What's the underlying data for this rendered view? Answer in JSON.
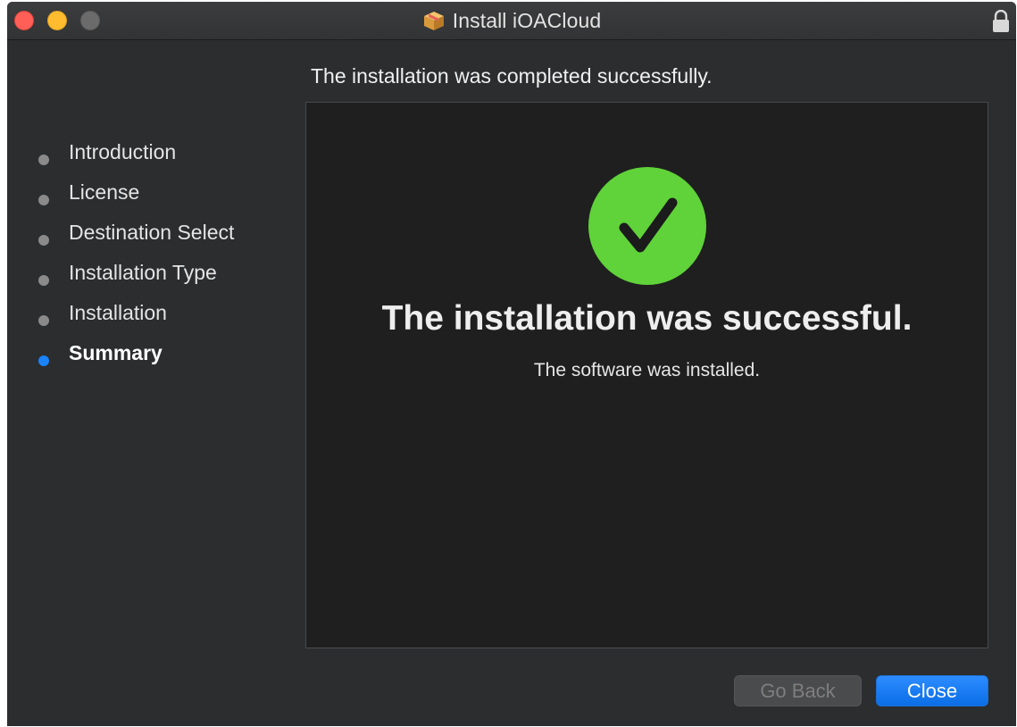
{
  "window": {
    "title": "Install iOACloud",
    "app_icon": "package-icon",
    "lock_icon": "lock-icon"
  },
  "header": {
    "text": "The installation was completed successfully."
  },
  "sidebar": {
    "steps": [
      {
        "label": "Introduction",
        "active": false
      },
      {
        "label": "License",
        "active": false
      },
      {
        "label": "Destination Select",
        "active": false
      },
      {
        "label": "Installation Type",
        "active": false
      },
      {
        "label": "Installation",
        "active": false
      },
      {
        "label": "Summary",
        "active": true
      }
    ]
  },
  "main": {
    "icon": "checkmark-circle-icon",
    "title": "The installation was successful.",
    "subtitle": "The software was installed."
  },
  "buttons": {
    "back_label": "Go Back",
    "back_enabled": false,
    "close_label": "Close"
  },
  "colors": {
    "accent": "#1a82fb",
    "success": "#5fd339",
    "window_bg": "#2b2d2f",
    "panel_bg": "#1f1f1f"
  }
}
